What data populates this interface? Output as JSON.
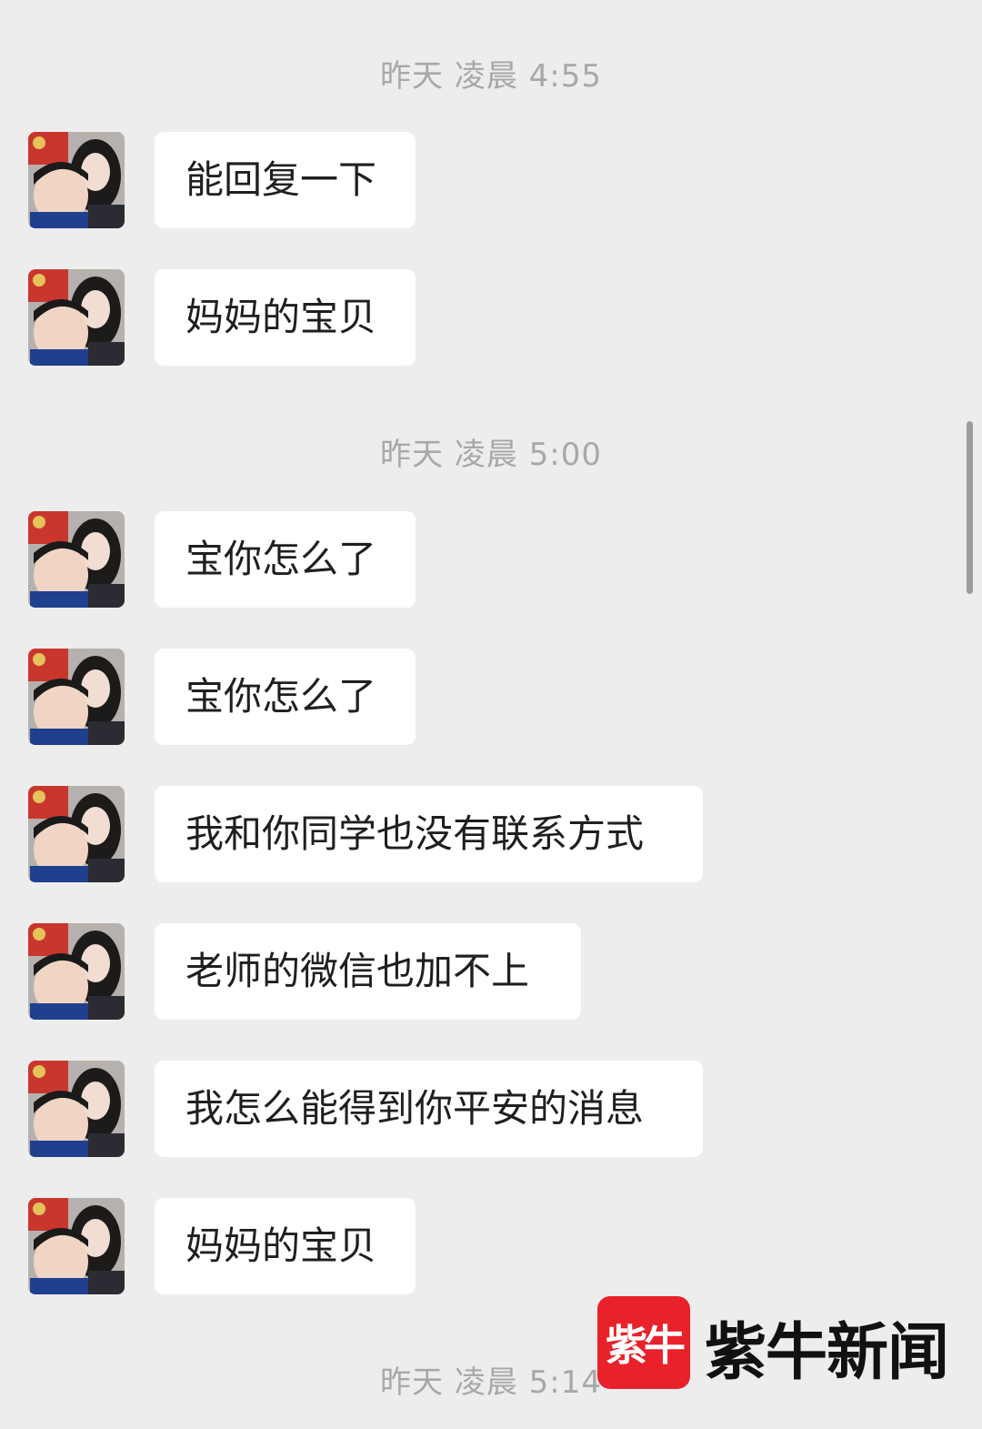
{
  "timestamps": [
    "昨天 凌晨 4:55",
    "昨天 凌晨 5:00",
    "昨天 凌晨 5:14"
  ],
  "messages": [
    {
      "text": "能回复一下"
    },
    {
      "text": "妈妈的宝贝"
    },
    {
      "text": "宝你怎么了"
    },
    {
      "text": "宝你怎么了"
    },
    {
      "text": "我和你同学也没有联系方式"
    },
    {
      "text": "老师的微信也加不上"
    },
    {
      "text": "我怎么能得到你平安的消息"
    },
    {
      "text": "妈妈的宝贝"
    }
  ],
  "watermark": {
    "logo_text": "紫牛",
    "name": "紫牛新闻"
  },
  "colors": {
    "background": "#ededed",
    "bubble": "#ffffff",
    "timestamp": "#a8a8a8",
    "watermark_red": "#e8212b"
  }
}
